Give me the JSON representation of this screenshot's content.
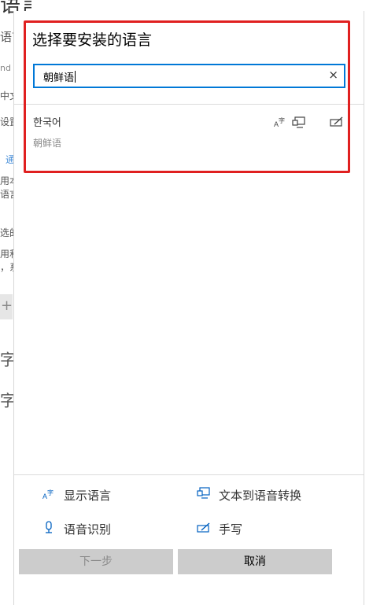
{
  "background": {
    "title": "语言",
    "fragments": [
      "语言",
      "nd",
      "中文",
      "设置",
      "通",
      "用本",
      "语言",
      "选的",
      "用和",
      "，系"
    ],
    "plus": "+",
    "big1": "字",
    "big2": "字"
  },
  "dialog": {
    "title": "选择要安装的语言",
    "search": {
      "value": "朝鲜语",
      "clear_icon": "×"
    },
    "results": [
      {
        "native_name": "한국어",
        "local_name": "朝鲜语",
        "features": [
          "display-language-icon",
          "text-to-speech-icon",
          "handwriting-icon"
        ]
      }
    ],
    "legend": {
      "display_language": "显示语言",
      "text_to_speech": "文本到语音转换",
      "speech_recognition": "语音识别",
      "handwriting": "手写"
    },
    "buttons": {
      "next": "下一步",
      "cancel": "取消"
    }
  },
  "colors": {
    "accent": "#0078d7",
    "highlight_outline": "#e02020",
    "button_bg": "#cccccc"
  }
}
